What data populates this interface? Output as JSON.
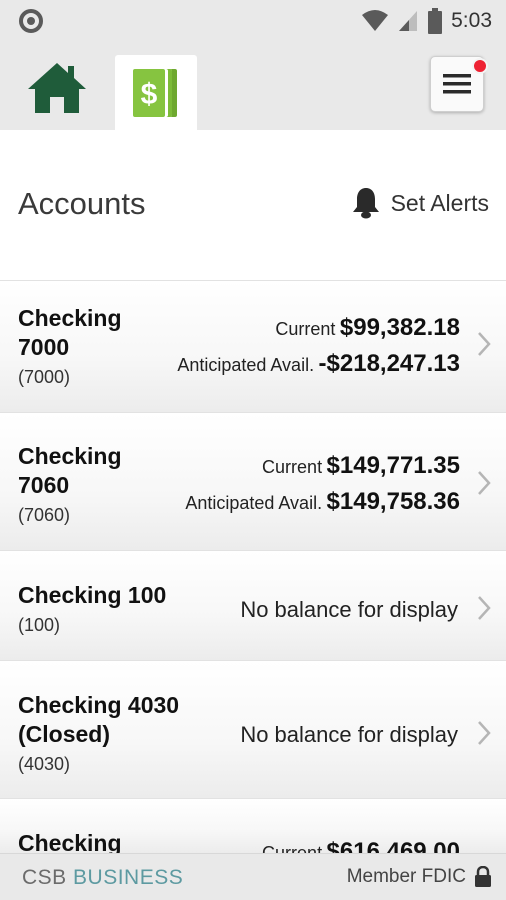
{
  "status_bar": {
    "time": "5:03",
    "icons": [
      "notification-dot-icon",
      "wifi-icon",
      "cell-signal-icon",
      "battery-icon"
    ]
  },
  "nav": {
    "icons": [
      "home-icon",
      "money-icon",
      "menu-icon"
    ],
    "active_tab": "money",
    "badge_color": "#ee2233"
  },
  "header": {
    "title": "Accounts",
    "alerts_label": "Set Alerts"
  },
  "accounts": [
    {
      "name_line1": "Checking",
      "name_line2": "7000",
      "number": "(7000)",
      "current_label": "Current",
      "current_value": "$99,382.18",
      "avail_label": "Anticipated Avail.",
      "avail_value": "-$218,247.13"
    },
    {
      "name_line1": "Checking",
      "name_line2": "7060",
      "number": "(7060)",
      "current_label": "Current",
      "current_value": "$149,771.35",
      "avail_label": "Anticipated Avail.",
      "avail_value": "$149,758.36"
    },
    {
      "name_line1": "Checking 100",
      "number": "(100)",
      "balance_text": "No balance for display"
    },
    {
      "name_line1": "Checking 4030",
      "name_line2": "(Closed)",
      "number": "(4030)",
      "balance_text": "No balance for display"
    },
    {
      "name_line1": "Checking",
      "current_label": "Current",
      "current_value": "$616,469.00"
    }
  ],
  "footer": {
    "brand_part1": "CSB",
    "brand_part2": "BUSINESS",
    "member_label": "Member FDIC"
  },
  "colors": {
    "brand_green": "#1f5c3a",
    "money_green": "#86c440",
    "brand_teal": "#5d9aa1"
  }
}
